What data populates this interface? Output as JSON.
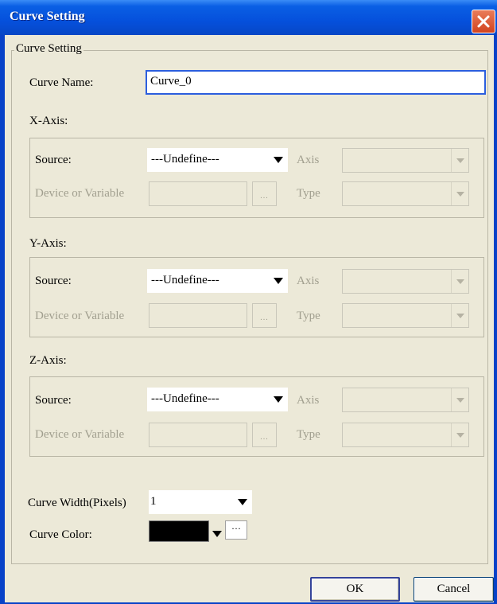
{
  "window": {
    "title": "Curve Setting"
  },
  "curve_setting_group": {
    "legend": "Curve Setting"
  },
  "curve_name": {
    "label": "Curve Name:",
    "value": "Curve_0"
  },
  "x_axis": {
    "heading": "X-Axis:",
    "source_label": "Source:",
    "source_value": "---Undefine---",
    "axis_label": "Axis",
    "axis_value": "",
    "device_label": "Device or Variable",
    "device_value": "",
    "browse_label": "...",
    "type_label": "Type",
    "type_value": ""
  },
  "y_axis": {
    "heading": "Y-Axis:",
    "source_label": "Source:",
    "source_value": "---Undefine---",
    "axis_label": "Axis",
    "axis_value": "",
    "device_label": "Device or Variable",
    "device_value": "",
    "browse_label": "...",
    "type_label": "Type",
    "type_value": ""
  },
  "z_axis": {
    "heading": "Z-Axis:",
    "source_label": "Source:",
    "source_value": "---Undefine---",
    "axis_label": "Axis",
    "axis_value": "",
    "device_label": "Device or Variable",
    "device_value": "",
    "browse_label": "...",
    "type_label": "Type",
    "type_value": ""
  },
  "curve_width": {
    "label": "Curve Width(Pixels)",
    "value": "1"
  },
  "curve_color": {
    "label": "Curve Color:",
    "color": "#000000",
    "more_label": "···"
  },
  "buttons": {
    "ok": "OK",
    "cancel": "Cancel"
  }
}
